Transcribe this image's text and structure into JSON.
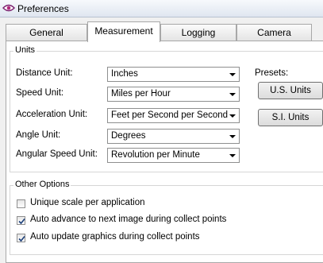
{
  "window": {
    "title": "Preferences",
    "icon": "eye-icon"
  },
  "tabs": [
    {
      "label": "General",
      "active": false
    },
    {
      "label": "Measurement",
      "active": true
    },
    {
      "label": "Logging",
      "active": false
    },
    {
      "label": "Camera",
      "active": false
    }
  ],
  "units": {
    "legend": "Units",
    "fields": [
      {
        "label": "Distance Unit:",
        "value": "Inches"
      },
      {
        "label": "Speed Unit:",
        "value": "Miles per Hour"
      },
      {
        "label": "Acceleration Unit:",
        "value": "Feet per Second per Second"
      },
      {
        "label": "Angle Unit:",
        "value": "Degrees"
      },
      {
        "label": "Angular Speed Unit:",
        "value": "Revolution per Minute"
      }
    ],
    "presets_label": "Presets:",
    "us_button": "U.S. Units",
    "si_button": "S.I. Units"
  },
  "options": {
    "legend": "Other Options",
    "items": [
      {
        "label": "Unique scale per application",
        "checked": false
      },
      {
        "label": "Auto advance to next image during collect points",
        "checked": true
      },
      {
        "label": "Auto update graphics during collect points",
        "checked": true
      }
    ]
  }
}
